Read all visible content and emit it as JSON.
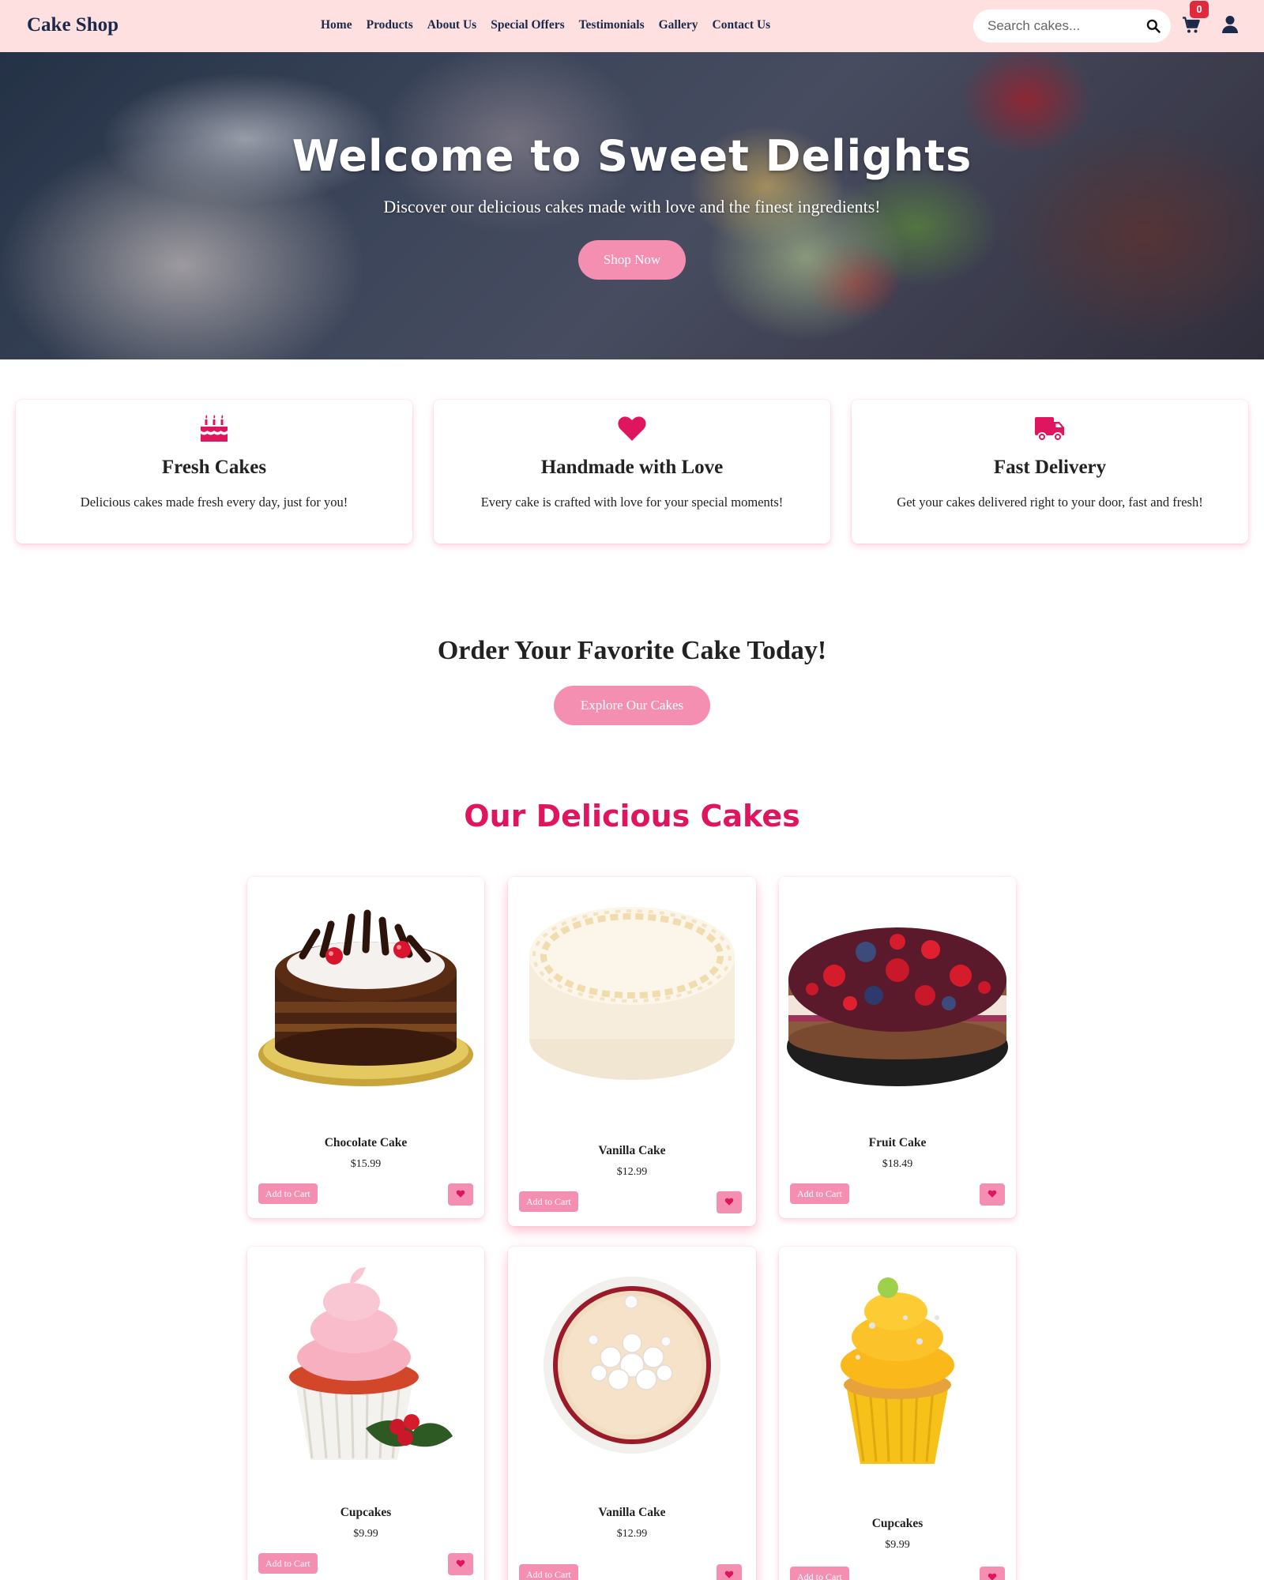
{
  "header": {
    "logo": "Cake Shop",
    "nav": [
      "Home",
      "Products",
      "About Us",
      "Special Offers",
      "Testimonials",
      "Gallery",
      "Contact Us"
    ],
    "search_placeholder": "Search cakes...",
    "cart_count": "0"
  },
  "hero": {
    "title": "Welcome to Sweet Delights",
    "subtitle": "Discover our delicious cakes made with love and the finest ingredients!",
    "button": "Shop Now"
  },
  "features": [
    {
      "icon": "birthday-cake-icon",
      "title": "Fresh Cakes",
      "text": "Delicious cakes made fresh every day, just for you!"
    },
    {
      "icon": "heart-icon",
      "title": "Handmade with Love",
      "text": "Every cake is crafted with love for your special moments!"
    },
    {
      "icon": "truck-icon",
      "title": "Fast Delivery",
      "text": "Get your cakes delivered right to your door, fast and fresh!"
    }
  ],
  "cta": {
    "title": "Order Your Favorite Cake Today!",
    "button": "Explore Our Cakes"
  },
  "products_section": {
    "title": "Our Delicious Cakes",
    "add_label": "Add to Cart",
    "items": [
      {
        "name": "Chocolate Cake",
        "price": "$15.99"
      },
      {
        "name": "Vanilla Cake",
        "price": "$12.99"
      },
      {
        "name": "Fruit Cake",
        "price": "$18.49"
      },
      {
        "name": "Cupcakes",
        "price": "$9.99"
      },
      {
        "name": "Vanilla Cake",
        "price": "$12.99"
      },
      {
        "name": "Cupcakes",
        "price": "$9.99"
      }
    ]
  },
  "colors": {
    "header_bg": "#ffe0e0",
    "brand_navy": "#1b2a4a",
    "accent_pink": "#f48fb1",
    "title_pink": "#e0155f",
    "badge_red": "#e02a3c"
  }
}
